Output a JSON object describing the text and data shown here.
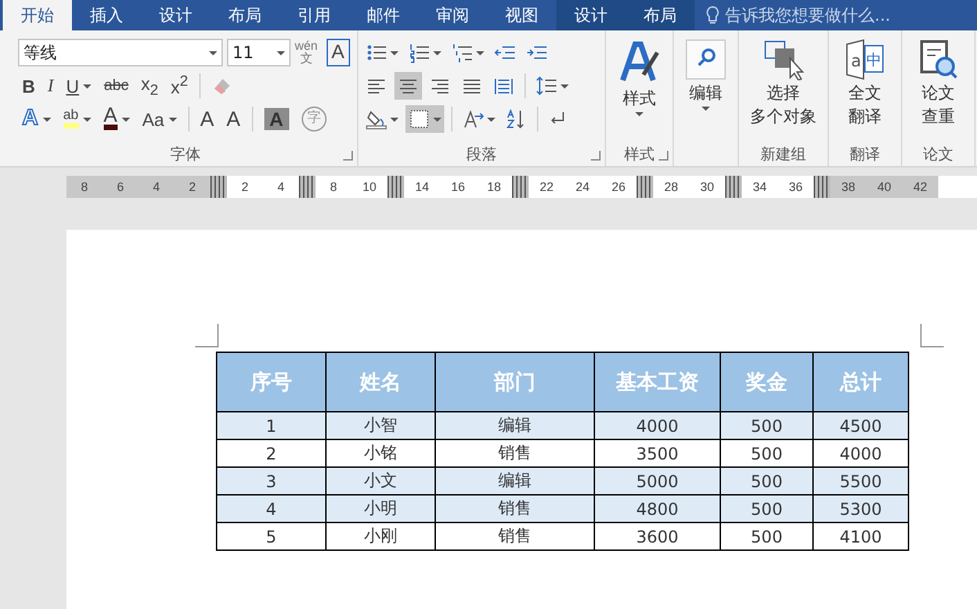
{
  "tabs": [
    {
      "label": "开始",
      "selected": true,
      "kind": "normal"
    },
    {
      "label": "插入",
      "selected": false,
      "kind": "normal"
    },
    {
      "label": "设计",
      "selected": false,
      "kind": "normal"
    },
    {
      "label": "布局",
      "selected": false,
      "kind": "normal"
    },
    {
      "label": "引用",
      "selected": false,
      "kind": "normal"
    },
    {
      "label": "邮件",
      "selected": false,
      "kind": "normal"
    },
    {
      "label": "审阅",
      "selected": false,
      "kind": "normal"
    },
    {
      "label": "视图",
      "selected": false,
      "kind": "normal"
    },
    {
      "label": "设计",
      "selected": false,
      "kind": "contextual"
    },
    {
      "label": "布局",
      "selected": false,
      "kind": "contextual"
    }
  ],
  "search": {
    "placeholder": "告诉我您想要做什么..."
  },
  "font_group": {
    "label": "字体",
    "font": "等线",
    "size": "11",
    "row1": [
      {
        "kind": "phonetic",
        "glyph": "文",
        "ruby": "wén"
      },
      {
        "kind": "boxed",
        "glyph": "A"
      }
    ],
    "row2": [
      {
        "kind": "bold",
        "glyph": "B"
      },
      {
        "kind": "italic",
        "glyph": "I"
      },
      {
        "kind": "underline",
        "glyph": "U",
        "dropdown": true
      },
      {
        "kind": "strike",
        "glyph": "abc"
      },
      {
        "kind": "sub",
        "glyph": "x$_{2}$"
      },
      {
        "kind": "sup",
        "glyph": "x$^{2}$"
      },
      {
        "kind": "separator"
      },
      {
        "kind": "eraser"
      }
    ],
    "row3": [
      {
        "kind": "effect",
        "glyph": "A",
        "dropdown": true
      },
      {
        "kind": "highlight",
        "glyph": "ab",
        "dropdown": true
      },
      {
        "kind": "color",
        "glyph": "A",
        "dropdown": true
      },
      {
        "kind": "plain",
        "glyph": "Aa",
        "dropdown": true
      },
      {
        "kind": "separator"
      },
      {
        "kind": "grow",
        "glyph": "A"
      },
      {
        "kind": "shrink",
        "glyph": "A"
      },
      {
        "kind": "separator"
      },
      {
        "kind": "shaded",
        "glyph": "A"
      },
      {
        "kind": "circled",
        "glyph": "字"
      }
    ]
  },
  "paragraph_group": {
    "label": "段落",
    "alignment": [
      {
        "selected": false
      },
      {
        "selected": true
      },
      {
        "selected": false
      },
      {
        "selected": false
      },
      {
        "selected": false
      }
    ],
    "borders": {
      "pressed": true
    }
  },
  "styles_group": {
    "button": "样式",
    "label": "样式"
  },
  "editing": {
    "button": "编辑"
  },
  "new_group": {
    "lines": [
      "选择",
      "多个对象"
    ],
    "label": "新建组"
  },
  "translate_group": {
    "lines": [
      "全文",
      "翻译"
    ],
    "icon_glyphs": [
      "a",
      "中"
    ],
    "label": "翻译"
  },
  "thesis_group": {
    "lines": [
      "论文",
      "查重"
    ],
    "label": "论文"
  },
  "ruler": [
    {
      "kind": "number",
      "text": "8"
    },
    {
      "kind": "number",
      "text": "6"
    },
    {
      "kind": "number",
      "text": "4"
    },
    {
      "kind": "number",
      "text": "2"
    },
    {
      "kind": "marker"
    },
    {
      "kind": "number",
      "text": "2",
      "light": true
    },
    {
      "kind": "number",
      "text": "4",
      "light": true
    },
    {
      "kind": "marker"
    },
    {
      "kind": "number",
      "text": "8",
      "light": true
    },
    {
      "kind": "number",
      "text": "10",
      "light": true
    },
    {
      "kind": "marker"
    },
    {
      "kind": "number",
      "text": "14",
      "light": true
    },
    {
      "kind": "number",
      "text": "16",
      "light": true
    },
    {
      "kind": "number",
      "text": "18",
      "light": true
    },
    {
      "kind": "marker"
    },
    {
      "kind": "number",
      "text": "22",
      "light": true
    },
    {
      "kind": "number",
      "text": "24",
      "light": true
    },
    {
      "kind": "number",
      "text": "26",
      "light": true
    },
    {
      "kind": "marker"
    },
    {
      "kind": "number",
      "text": "28",
      "light": true
    },
    {
      "kind": "number",
      "text": "30",
      "light": true
    },
    {
      "kind": "marker"
    },
    {
      "kind": "number",
      "text": "34",
      "light": true
    },
    {
      "kind": "number",
      "text": "36",
      "light": true
    },
    {
      "kind": "marker"
    },
    {
      "kind": "number",
      "text": "38"
    },
    {
      "kind": "number",
      "text": "40"
    },
    {
      "kind": "number",
      "text": "42"
    }
  ],
  "table": {
    "columns": [
      "序号",
      "姓名",
      "部门",
      "基本工资",
      "奖金",
      "总计"
    ],
    "rows": [
      {
        "cells": [
          "1",
          "小智",
          "编辑",
          "4000",
          "500",
          "4500"
        ],
        "shaded": true
      },
      {
        "cells": [
          "2",
          "小铭",
          "销售",
          "3500",
          "500",
          "4000"
        ],
        "shaded": false
      },
      {
        "cells": [
          "3",
          "小文",
          "编辑",
          "5000",
          "500",
          "5500"
        ],
        "shaded": true
      },
      {
        "cells": [
          "4",
          "小明",
          "销售",
          "4800",
          "500",
          "5300"
        ],
        "shaded": true
      },
      {
        "cells": [
          "5",
          "小刚",
          "销售",
          "3600",
          "500",
          "4100"
        ],
        "shaded": false
      }
    ]
  }
}
